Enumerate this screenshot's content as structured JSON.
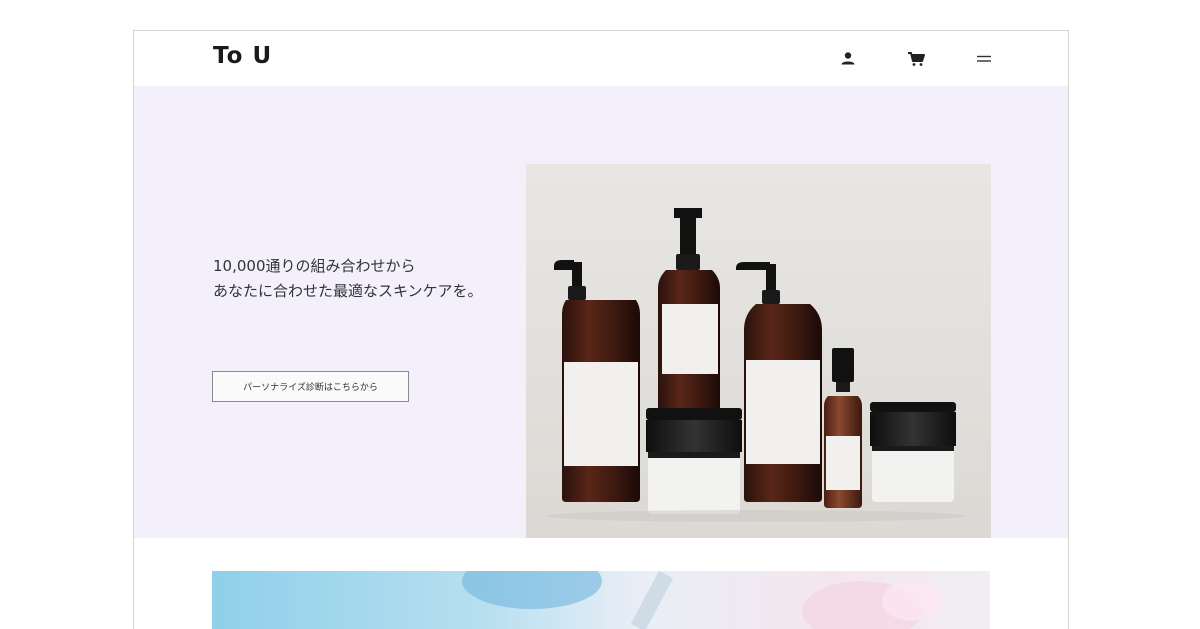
{
  "header": {
    "logo": "To U",
    "icons": [
      "user-icon",
      "cart-icon",
      "menu-icon"
    ]
  },
  "hero": {
    "tagline_line1": "10,000通りの組み合わせから",
    "tagline_line2": "あなたに合わせた最適なスキンケアを。",
    "cta_label": "パーソナライズ診断はこちらから",
    "background": "#f3f0fc"
  }
}
